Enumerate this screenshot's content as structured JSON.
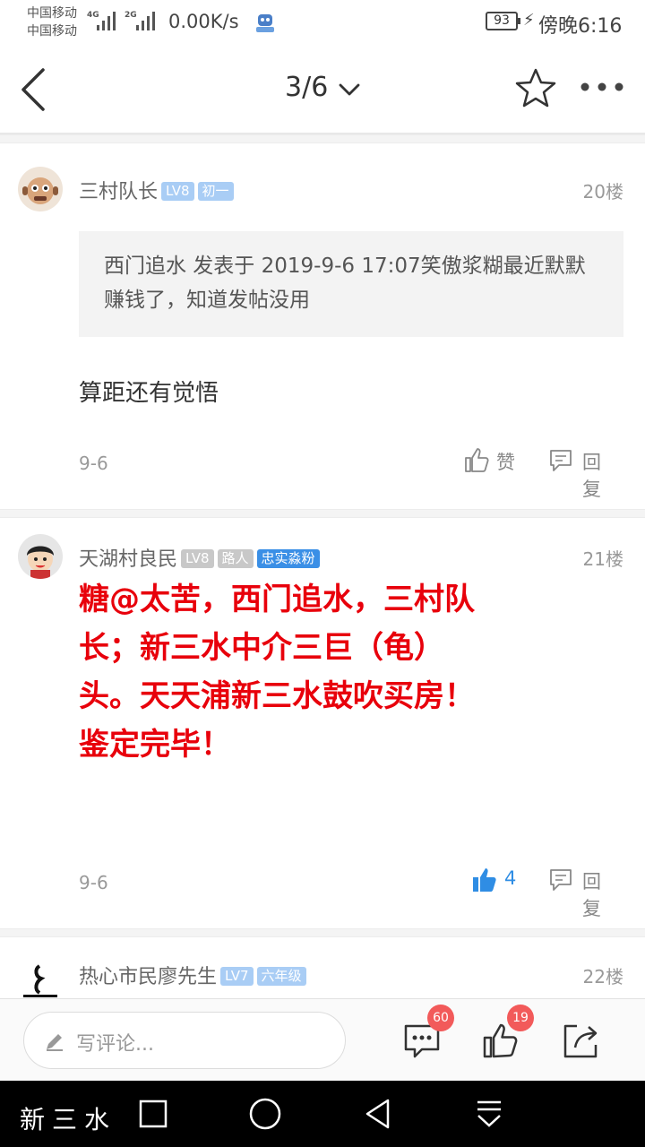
{
  "status_bar": {
    "carrier1": "中国移动",
    "carrier2": "中国移动",
    "net1": "4G",
    "net2": "2G",
    "net_speed": "0.00K/s",
    "battery": "93",
    "time": "傍晚6:16"
  },
  "nav": {
    "pager": "3/6"
  },
  "posts": [
    {
      "author": "三村队长",
      "level": "LV8",
      "title_badge": "初一",
      "floor": "20楼",
      "quote": "西门追水 发表于 2019-9-6 17:07笑傲浆糊最近默默赚钱了，知道发帖没用",
      "content": "算距还有觉悟",
      "date": "9-6",
      "like_label": "赞",
      "reply_label": "回复"
    },
    {
      "author": "天湖村良民",
      "level": "LV8",
      "title_badge": "路人",
      "extra_badge": "忠实淼粉",
      "floor": "21楼",
      "content_lines": [
        "糖@太苦，西门追水，三村队",
        "长；新三水中介三巨（龟）",
        "头。天天浦新三水鼓吹买房！",
        "鉴定完毕！"
      ],
      "date": "9-6",
      "like_count": "4",
      "reply_label": "回复"
    },
    {
      "author": "热心市民廖先生",
      "level": "LV7",
      "title_badge": "六年级",
      "floor": "22楼"
    }
  ],
  "comment_bar": {
    "placeholder": "写评论...",
    "comment_count": "60",
    "like_count": "19"
  },
  "watermark": "新三水",
  "colors": {
    "accent_blue": "#2f8de4",
    "highlight_red": "#e8000b",
    "badge_red": "#f25a5a"
  }
}
